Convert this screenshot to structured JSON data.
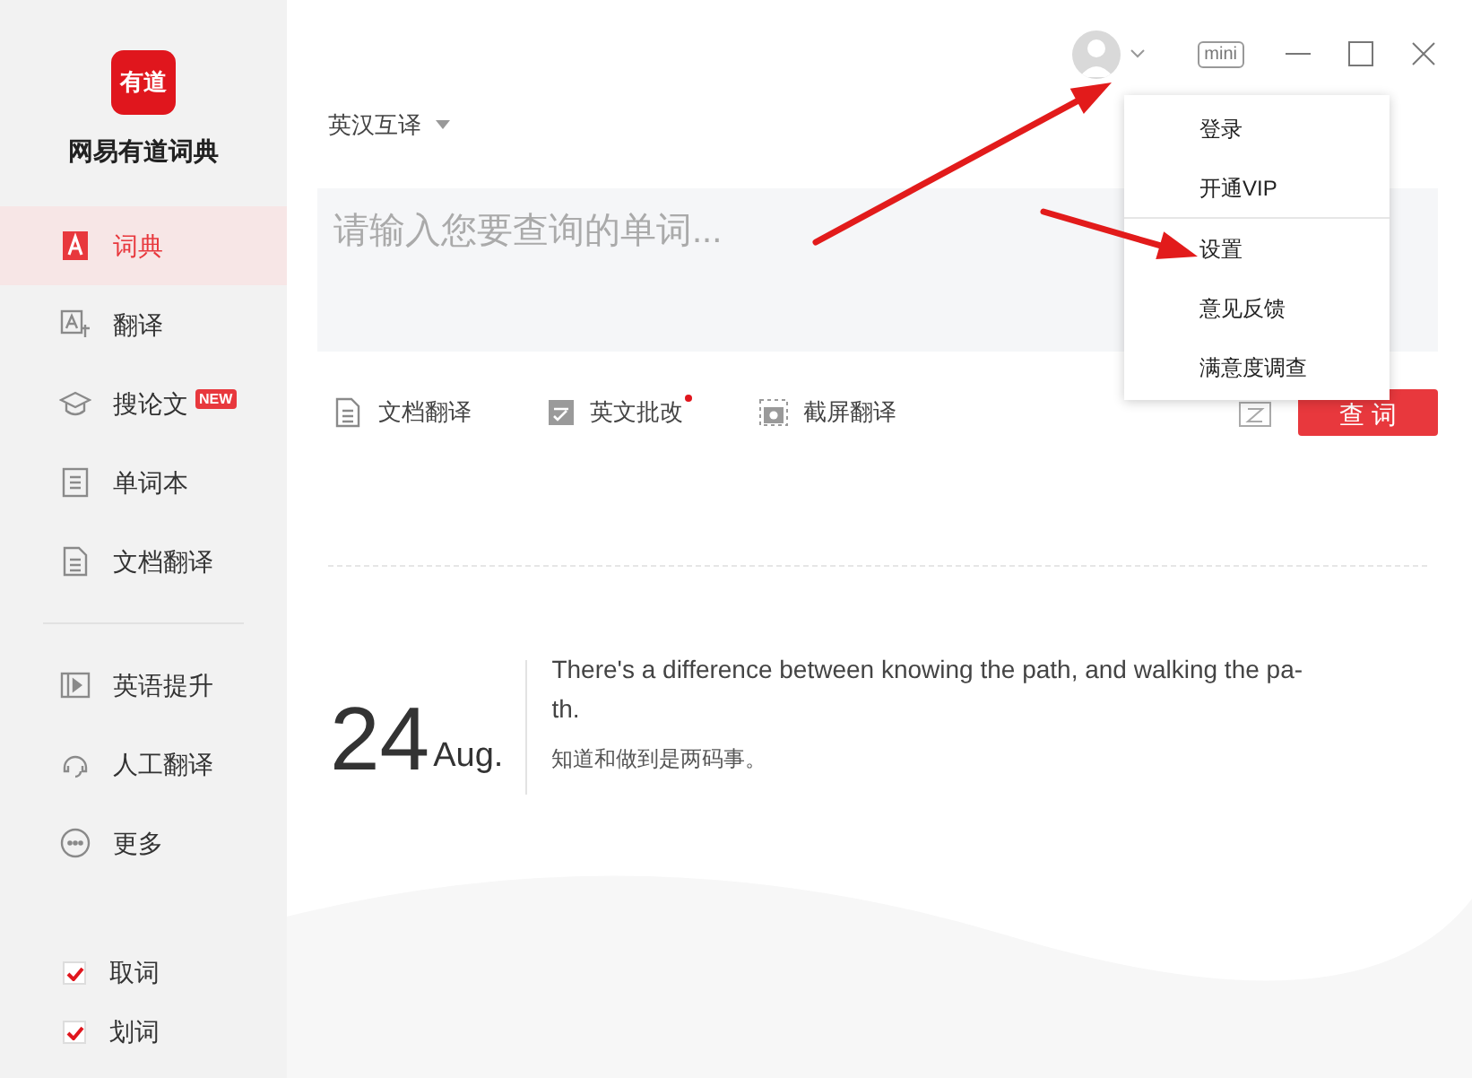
{
  "app": {
    "logo_text": "有道",
    "name": "网易有道词典"
  },
  "sidebar": {
    "nav": [
      {
        "label": "词典",
        "kind": "dict",
        "selected": true
      },
      {
        "label": "翻译",
        "kind": "translate",
        "selected": false
      },
      {
        "label": "搜论文",
        "kind": "cap",
        "selected": false,
        "badge": "NEW"
      },
      {
        "label": "单词本",
        "kind": "book",
        "selected": false
      },
      {
        "label": "文档翻译",
        "kind": "doc",
        "selected": false
      }
    ],
    "more": [
      {
        "label": "英语提升",
        "kind": "video",
        "selected": false
      },
      {
        "label": "人工翻译",
        "kind": "headset",
        "selected": false
      },
      {
        "label": "更多",
        "kind": "dots",
        "selected": false
      }
    ],
    "toggles": [
      {
        "label": "取词",
        "checked": true
      },
      {
        "label": "划词",
        "checked": true
      }
    ]
  },
  "titlebar": {
    "mini": "mini"
  },
  "language": "英汉互译",
  "search": {
    "placeholder": "请输入您要查询的单词..."
  },
  "tools": [
    {
      "label": "文档翻译",
      "kind": "doc",
      "dot": false
    },
    {
      "label": "英文批改",
      "kind": "check",
      "dot": true
    },
    {
      "label": "截屏翻译",
      "kind": "camera",
      "dot": false
    }
  ],
  "query_button": "查 词",
  "daily": {
    "day": "24",
    "month": "Aug.",
    "quote_lines": [
      "There's a difference between knowing the path, and walking the pa-",
      "th."
    ],
    "translation": "知道和做到是两码事。"
  },
  "menu": {
    "groups": [
      [
        "登录",
        "开通VIP"
      ],
      [
        "设置",
        "意见反馈",
        "满意度调查"
      ]
    ]
  }
}
